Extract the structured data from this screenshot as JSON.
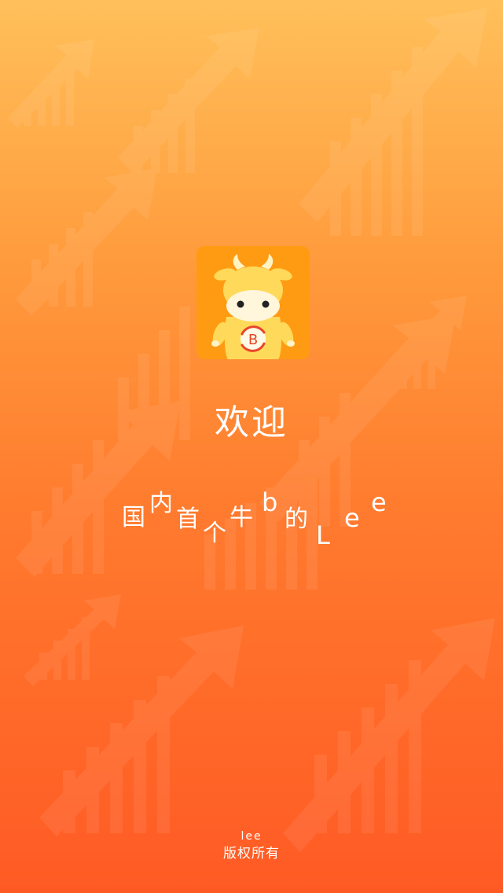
{
  "splash": {
    "welcome": "欢迎",
    "slogan_chars": [
      "国",
      "内",
      "首",
      "个",
      "牛",
      "b",
      "的",
      "L",
      "e",
      "e"
    ],
    "footer_owner": "lee",
    "footer_rights": "版权所有"
  },
  "logo": {
    "badge_letter": "B",
    "icon": "cow-mascot-icon"
  },
  "colors": {
    "gradient_top": "#ffc05a",
    "gradient_bottom": "#ff5a24",
    "logo_background": "#ff9b12",
    "cow_yellow": "#ffd95a",
    "badge_red": "#e8462a"
  }
}
